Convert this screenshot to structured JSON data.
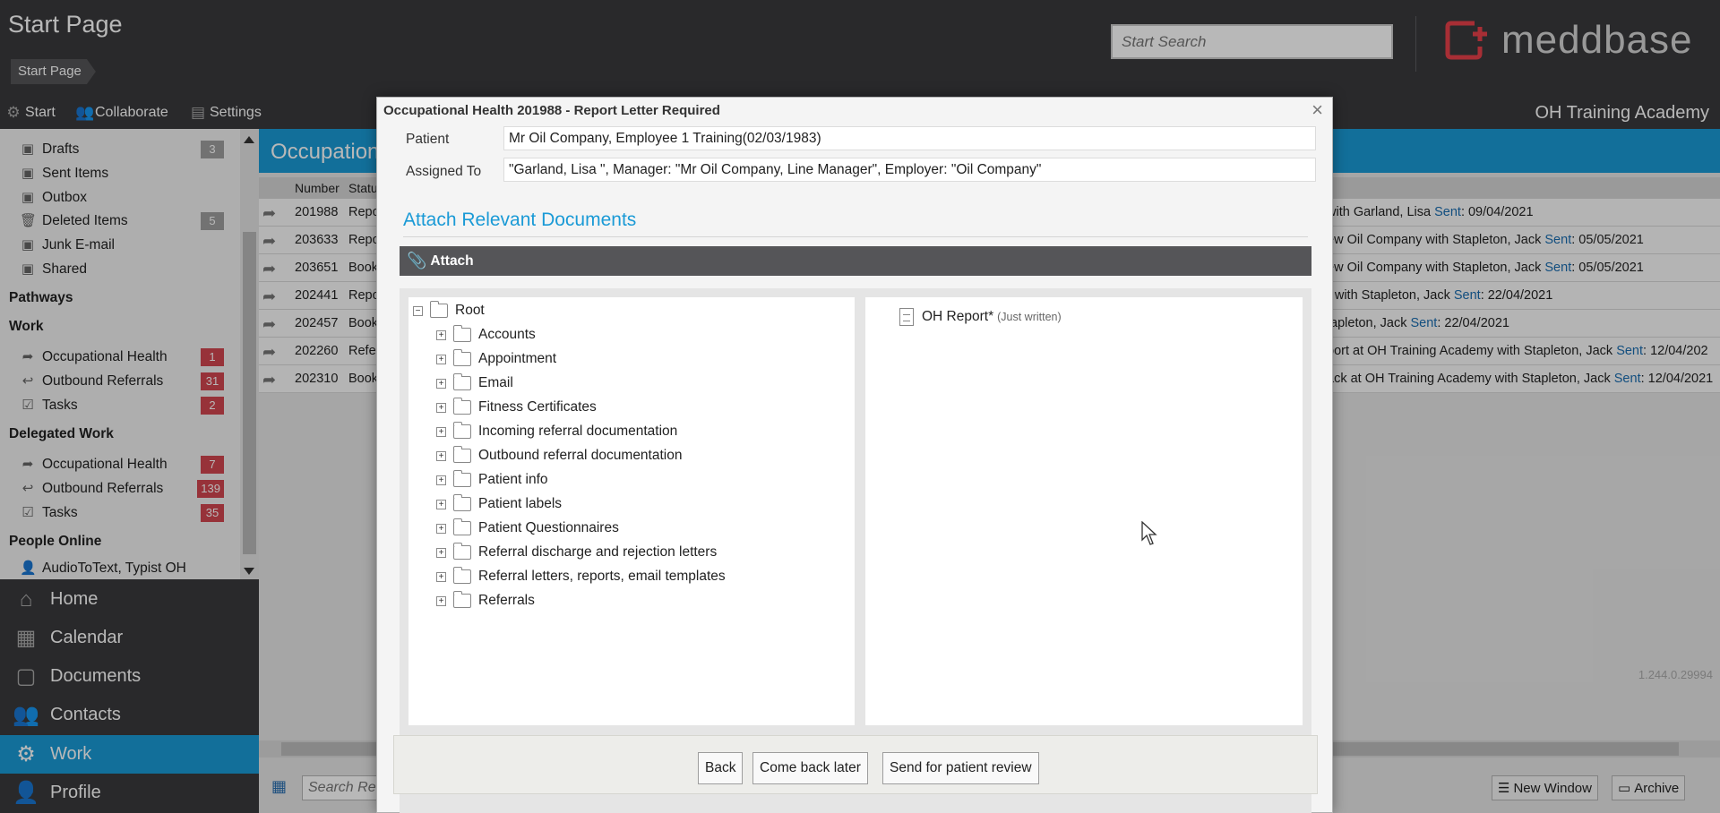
{
  "header": {
    "title": "Start Page",
    "breadcrumb": "Start Page",
    "search_placeholder": "Start Search",
    "logo_text": "meddbase"
  },
  "toolbar": {
    "start": "Start",
    "collaborate": "Collaborate",
    "settings": "Settings",
    "organisation": "OH Training Academy"
  },
  "sidebar": {
    "mail": [
      {
        "label": "Drafts",
        "badge": "3"
      },
      {
        "label": "Sent Items",
        "badge": ""
      },
      {
        "label": "Outbox",
        "badge": ""
      },
      {
        "label": "Deleted Items",
        "badge": "5"
      },
      {
        "label": "Junk E-mail",
        "badge": ""
      },
      {
        "label": "Shared",
        "badge": ""
      }
    ],
    "pathways_heading": "Pathways",
    "work_heading": "Work",
    "work": [
      {
        "label": "Occupational Health",
        "badge": "1"
      },
      {
        "label": "Outbound Referrals",
        "badge": "31"
      },
      {
        "label": "Tasks",
        "badge": "2"
      }
    ],
    "delegated_heading": "Delegated Work",
    "delegated": [
      {
        "label": "Occupational Health",
        "badge": "7"
      },
      {
        "label": "Outbound Referrals",
        "badge": "139"
      },
      {
        "label": "Tasks",
        "badge": "35"
      }
    ],
    "people_heading": "People Online",
    "people": [
      {
        "label": "AudioToText, Typist OH"
      }
    ]
  },
  "bottom_nav": [
    {
      "label": "Home",
      "icon": "home-icon"
    },
    {
      "label": "Calendar",
      "icon": "calendar-icon"
    },
    {
      "label": "Documents",
      "icon": "documents-icon"
    },
    {
      "label": "Contacts",
      "icon": "contacts-icon"
    },
    {
      "label": "Work",
      "icon": "gear-icon"
    },
    {
      "label": "Profile",
      "icon": "profile-icon"
    }
  ],
  "main": {
    "title": "Occupation",
    "columns": [
      "Number",
      "Statu"
    ],
    "rows": [
      {
        "number": "201988",
        "status": "Repo",
        "tail": "with Garland, Lisa ",
        "sent_label": "Sent",
        "date": ": 09/04/2021"
      },
      {
        "number": "203633",
        "status": "Repo",
        "tail": "ew Oil Company with Stapleton, Jack ",
        "sent_label": "Sent",
        "date": ": 05/05/2021"
      },
      {
        "number": "203651",
        "status": "Book",
        "tail": "ew Oil Company with Stapleton, Jack ",
        "sent_label": "Sent",
        "date": ": 05/05/2021"
      },
      {
        "number": "202441",
        "status": "Repo",
        "tail": "r with Stapleton, Jack ",
        "sent_label": "Sent",
        "date": ": 22/04/2021"
      },
      {
        "number": "202457",
        "status": "Book",
        "tail": "tapleton, Jack ",
        "sent_label": "Sent",
        "date": ": 22/04/2021"
      },
      {
        "number": "202260",
        "status": "Refe",
        "tail": "port at OH Training Academy with Stapleton, Jack ",
        "sent_label": "Sent",
        "date": ": 12/04/202"
      },
      {
        "number": "202310",
        "status": "Book",
        "tail": "ack at OH Training Academy with Stapleton, Jack ",
        "sent_label": "Sent",
        "date": ": 12/04/2021"
      }
    ],
    "footer_search_placeholder": "Search Re",
    "new_window": "New Window",
    "archive": "Archive",
    "version": "1.244.0.29994"
  },
  "dialog": {
    "title": "Occupational Health 201988 - Report Letter Required",
    "patient_label": "Patient",
    "patient_value": "Mr Oil Company, Employee 1 Training(02/03/1983)",
    "assigned_label": "Assigned To",
    "assigned_value": "\"Garland, Lisa \", Manager: \"Mr Oil Company, Line Manager\", Employer: \"Oil Company\"",
    "section_title": "Attach Relevant Documents",
    "attach_label": "Attach",
    "tree": {
      "root": "Root",
      "folders": [
        "Accounts",
        "Appointment",
        "Email",
        "Fitness Certificates",
        "Incoming referral documentation",
        "Outbound referral documentation",
        "Patient info",
        "Patient labels",
        "Patient Questionnaires",
        "Referral discharge and rejection letters",
        "Referral letters, reports, email templates",
        "Referrals"
      ]
    },
    "attached": {
      "name": "OH Report*",
      "note": "(Just written)"
    },
    "buttons": {
      "back": "Back",
      "later": "Come back later",
      "send": "Send for patient review"
    }
  }
}
